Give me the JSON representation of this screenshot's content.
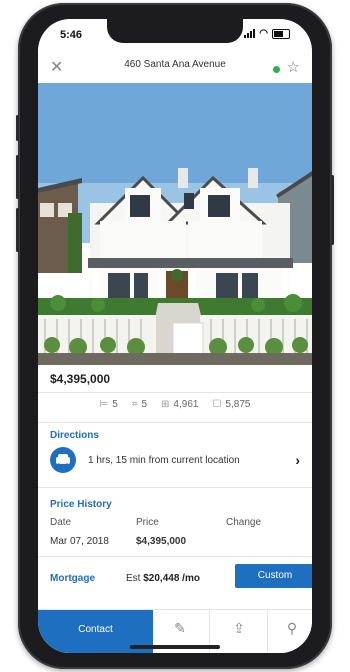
{
  "status": {
    "time": "5:46"
  },
  "nav": {
    "title": "460 Santa Ana Avenue",
    "close_icon": "close-icon",
    "favorite_icon": "star-icon",
    "status_color": "#2bb04a"
  },
  "listing": {
    "price": "$4,395,000",
    "stats": [
      {
        "icon": "bed-icon",
        "value": "5"
      },
      {
        "icon": "bath-icon",
        "value": "5"
      },
      {
        "icon": "area-icon",
        "value": "4,961"
      },
      {
        "icon": "lot-icon",
        "value": "5,875"
      }
    ]
  },
  "directions": {
    "title": "Directions",
    "text": "1 hrs, 15 min from current location"
  },
  "price_history": {
    "title": "Price History",
    "headers": [
      "Date",
      "Price",
      "Change"
    ],
    "rows": [
      {
        "date": "Mar 07, 2018",
        "price": "$4,395,000",
        "change": ""
      }
    ]
  },
  "mortgage": {
    "label": "Mortgage",
    "est_prefix": "Est",
    "amount": "$20,448 /mo",
    "button": "Custom"
  },
  "tabbar": {
    "contact": "Contact",
    "icons": [
      "pencil-icon",
      "share-icon",
      "location-pin-icon"
    ]
  },
  "colors": {
    "accent": "#1f6fc0",
    "accent_text": "#1e6fbd"
  }
}
